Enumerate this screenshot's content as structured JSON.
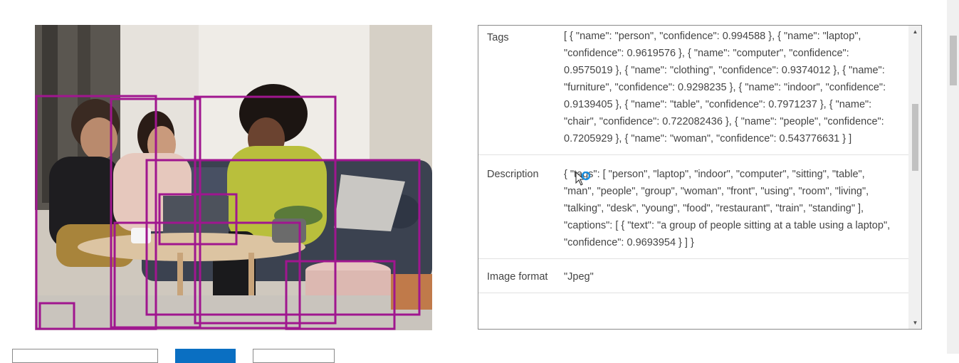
{
  "image_panel": {
    "detected_objects": [
      "person",
      "person",
      "person",
      "laptop",
      "furniture",
      "table",
      "chair"
    ]
  },
  "results": {
    "rows": [
      {
        "key": "Tags",
        "value": "[ { \"name\": \"person\", \"confidence\": 0.994588 }, { \"name\": \"laptop\", \"confidence\": 0.9619576 }, { \"name\": \"computer\", \"confidence\": 0.9575019 }, { \"name\": \"clothing\", \"confidence\": 0.9374012 }, { \"name\": \"furniture\", \"confidence\": 0.9298235 }, { \"name\": \"indoor\", \"confidence\": 0.9139405 }, { \"name\": \"table\", \"confidence\": 0.7971237 }, { \"name\": \"chair\", \"confidence\": 0.722082436 }, { \"name\": \"people\", \"confidence\": 0.7205929 }, { \"name\": \"woman\", \"confidence\": 0.543776631 } ]"
      },
      {
        "key": "Description",
        "value": "{ \"tags\": [ \"person\", \"laptop\", \"indoor\", \"computer\", \"sitting\", \"table\", \"man\", \"people\", \"group\", \"woman\", \"front\", \"using\", \"room\", \"living\", \"talking\", \"desk\", \"young\", \"food\", \"restaurant\", \"train\", \"standing\" ], \"captions\": [ { \"text\": \"a group of people sitting at a table using a laptop\", \"confidence\": 0.9693954 } ] }"
      },
      {
        "key": "Image format",
        "value": "\"Jpeg\""
      }
    ]
  },
  "colors": {
    "bbox": "#a0168f",
    "primary_button": "#0a6fc2",
    "cursor_ring": "#1a8fe0"
  },
  "icons": {
    "scroll_up": "triangle-up-icon",
    "scroll_down": "triangle-down-icon",
    "cursor": "mouse-pointer-busy-icon"
  }
}
